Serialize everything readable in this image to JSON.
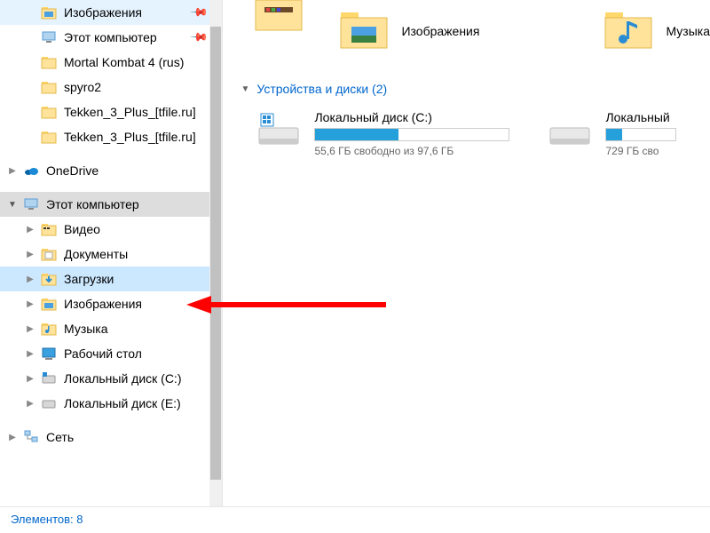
{
  "sidebar": {
    "quick": [
      {
        "label": "Изображения",
        "icon": "pictures",
        "pinned": true
      },
      {
        "label": "Этот компьютер",
        "icon": "pc",
        "pinned": true
      },
      {
        "label": "Mortal Kombat 4 (rus)",
        "icon": "folder",
        "pinned": false
      },
      {
        "label": "spyro2",
        "icon": "folder",
        "pinned": false
      },
      {
        "label": "Tekken_3_Plus_[tfile.ru]",
        "icon": "folder",
        "pinned": false
      },
      {
        "label": "Tekken_3_Plus_[tfile.ru]",
        "icon": "folder",
        "pinned": false
      }
    ],
    "onedrive": {
      "label": "OneDrive"
    },
    "thispc": {
      "label": "Этот компьютер",
      "children": [
        {
          "label": "Видео",
          "icon": "video"
        },
        {
          "label": "Документы",
          "icon": "documents"
        },
        {
          "label": "Загрузки",
          "icon": "downloads",
          "selected": true
        },
        {
          "label": "Изображения",
          "icon": "pictures"
        },
        {
          "label": "Музыка",
          "icon": "music"
        },
        {
          "label": "Рабочий стол",
          "icon": "desktop"
        },
        {
          "label": "Локальный диск (C:)",
          "icon": "drive-c"
        },
        {
          "label": "Локальный диск (E:)",
          "icon": "drive"
        }
      ]
    },
    "network": {
      "label": "Сеть"
    }
  },
  "main": {
    "folders": [
      {
        "label": "Изображения",
        "icon": "pictures-big"
      },
      {
        "label": "Музыка",
        "icon": "music-big"
      }
    ],
    "section_title": "Устройства и диски (2)",
    "drives": [
      {
        "name": "Локальный диск (C:)",
        "sub": "55,6 ГБ свободно из 97,6 ГБ",
        "fill_pct": 43,
        "icon": "drive-c"
      },
      {
        "name": "Локальный",
        "sub": "729 ГБ сво",
        "fill_pct": 22,
        "icon": "drive"
      }
    ]
  },
  "status": "Элементов: 8"
}
